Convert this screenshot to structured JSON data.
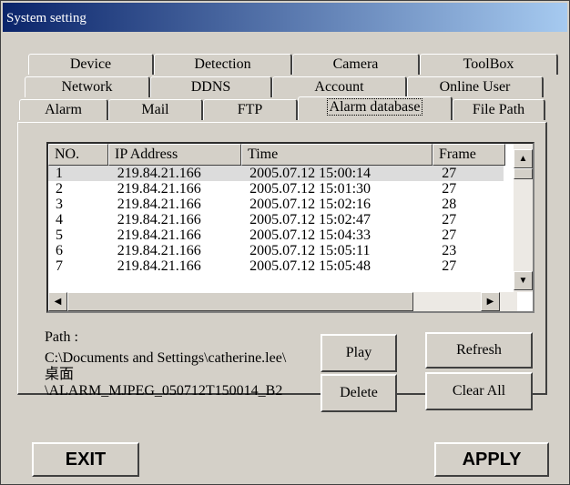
{
  "window": {
    "title": "System setting"
  },
  "tabs": {
    "row1": [
      "Device",
      "Detection",
      "Camera",
      "ToolBox"
    ],
    "row2": [
      "Network",
      "DDNS",
      "Account",
      "Online User"
    ],
    "row3": [
      "Alarm",
      "Mail",
      "FTP",
      "Alarm database",
      "File Path"
    ]
  },
  "list": {
    "headers": [
      "NO.",
      "IP Address",
      "Time",
      "Frame"
    ],
    "rows": [
      [
        "1",
        "219.84.21.166",
        "2005.07.12 15:00:14",
        "27"
      ],
      [
        "2",
        "219.84.21.166",
        "2005.07.12 15:01:30",
        "27"
      ],
      [
        "3",
        "219.84.21.166",
        "2005.07.12 15:02:16",
        "28"
      ],
      [
        "4",
        "219.84.21.166",
        "2005.07.12 15:02:47",
        "27"
      ],
      [
        "5",
        "219.84.21.166",
        "2005.07.12 15:04:33",
        "27"
      ],
      [
        "6",
        "219.84.21.166",
        "2005.07.12 15:05:11",
        "23"
      ],
      [
        "7",
        "219.84.21.166",
        "2005.07.12 15:05:48",
        "27"
      ]
    ]
  },
  "path": {
    "label": "Path :",
    "line1": "C:\\Documents and Settings\\catherine.lee\\",
    "line2": "桌面",
    "line3": "\\ALARM_MJPEG_050712T150014_B2"
  },
  "buttons": {
    "play": "Play",
    "refresh": "Refresh",
    "delete": "Delete",
    "clear_all": "Clear All",
    "exit": "EXIT",
    "apply": "APPLY"
  },
  "icons": {
    "scroll_up": "scroll-up-icon",
    "scroll_down": "scroll-down-icon",
    "scroll_left": "scroll-left-icon",
    "scroll_right": "scroll-right-icon"
  }
}
